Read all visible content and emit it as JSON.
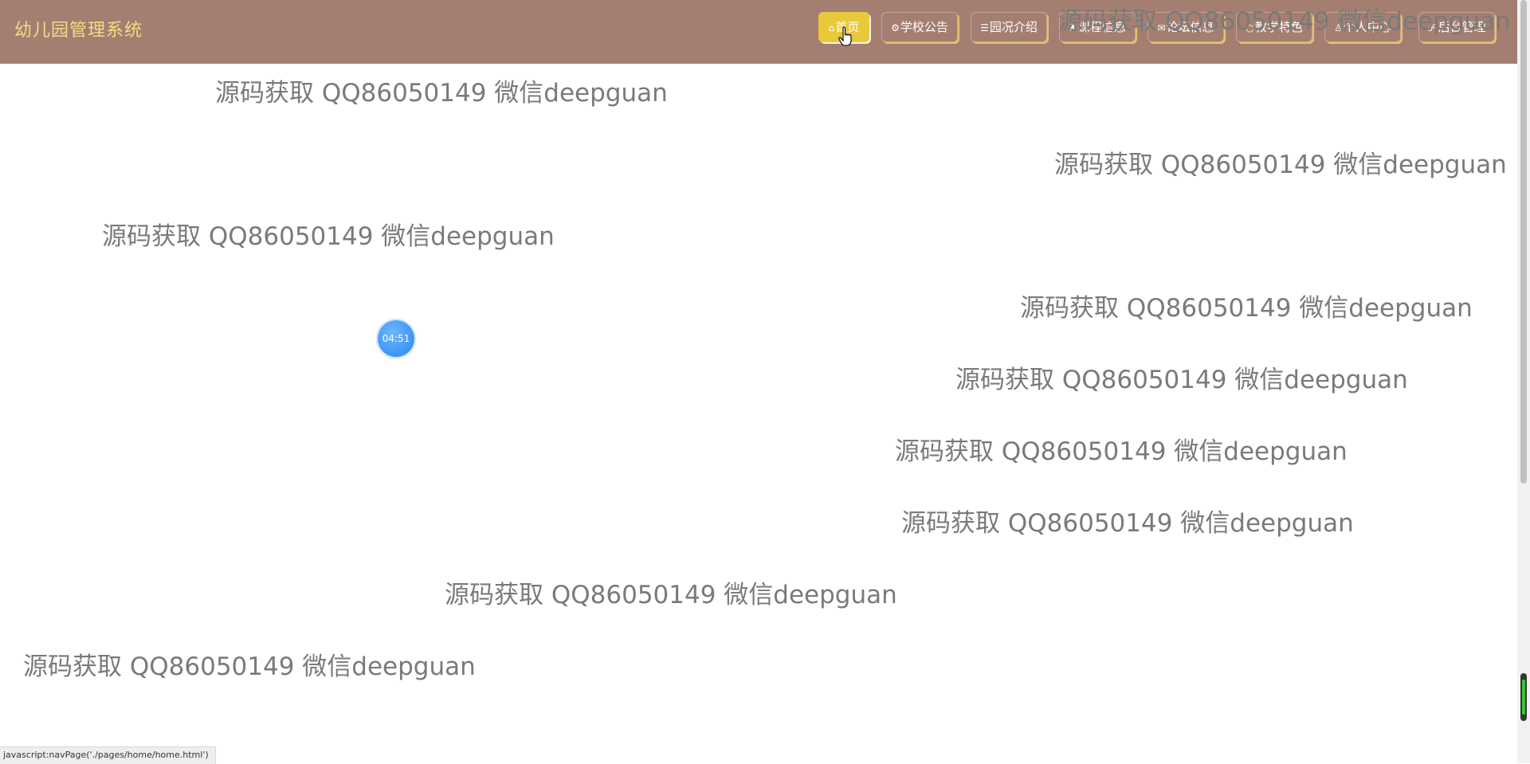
{
  "app": {
    "title": "幼儿园管理系统"
  },
  "nav": {
    "items": [
      {
        "icon": "⌂",
        "label": "首页",
        "active": true
      },
      {
        "icon": "⚙",
        "label": "学校公告"
      },
      {
        "icon": "☰",
        "label": "园况介绍"
      },
      {
        "icon": "⚑",
        "label": "课程信息"
      },
      {
        "icon": "✉",
        "label": "论坛信息"
      },
      {
        "icon": "○",
        "label": "教学特色"
      },
      {
        "icon": "♙",
        "label": "个人中心"
      },
      {
        "icon": "☍",
        "label": "后台管理"
      }
    ]
  },
  "watermark": {
    "text": "源码获取 QQ86050149 微信deepguan"
  },
  "timer": {
    "value": "04:51"
  },
  "status_bar": {
    "url": "javascript:navPage('./pages/home/home.html')"
  },
  "colors": {
    "header_bg": "#a47f71",
    "brand_text": "#f5da86",
    "active_nav": "#e9c93b",
    "timer_blue": "#3b8fef"
  }
}
